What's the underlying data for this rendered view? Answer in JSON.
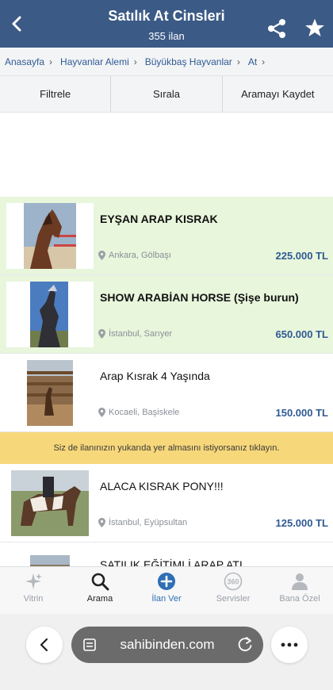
{
  "header": {
    "title": "Satılık At Cinsleri",
    "subtitle": "355 ilan",
    "back_icon": "chevron-left-icon",
    "share_icon": "share-icon",
    "favorite_icon": "star-icon"
  },
  "breadcrumb": [
    {
      "label": "Anasayfa"
    },
    {
      "label": "Hayvanlar Alemi"
    },
    {
      "label": "Büyükbaş Hayvanlar"
    },
    {
      "label": "At"
    }
  ],
  "filterbar": {
    "filter_label": "Filtrele",
    "sort_label": "Sırala",
    "save_label": "Aramayı Kaydet"
  },
  "listings": [
    {
      "title": "EYŞAN ARAP KISRAK",
      "location": "Ankara, Gölbaşı",
      "price": "225.000 TL",
      "featured": true
    },
    {
      "title": "SHOW ARABİAN HORSE (Şişe burun)",
      "location": "İstanbul, Sarıyer",
      "price": "650.000 TL",
      "featured": true
    },
    {
      "title": "Arap Kısrak 4 Yaşında",
      "location": "Kocaeli, Başiskele",
      "price": "150.000 TL",
      "featured": false
    },
    {
      "title": "ALACA KISRAK PONY!!!",
      "location": "İstanbul, Eyüpsultan",
      "price": "125.000 TL",
      "featured": false
    },
    {
      "title": "SATILIK EĞİTİMLİ ARAP ATI",
      "location": "",
      "price": "",
      "featured": false
    }
  ],
  "promo": {
    "text": "Siz de ilanınızın yukarıda yer almasını istiyorsanız tıklayın."
  },
  "tabbar": [
    {
      "label": "Vitrin",
      "icon": "sparkle-icon"
    },
    {
      "label": "Arama",
      "icon": "search-icon"
    },
    {
      "label": "İlan Ver",
      "icon": "plus-circle-icon"
    },
    {
      "label": "Servisler",
      "icon": "360-icon"
    },
    {
      "label": "Bana Özel",
      "icon": "person-icon"
    }
  ],
  "browser": {
    "domain": "sahibinden.com",
    "back_icon": "chevron-left-icon",
    "page_icon": "page-settings-icon",
    "reload_icon": "reload-icon",
    "more_icon": "more-icon"
  },
  "colors": {
    "header": "#3b5a86",
    "featured": "#e8f6dc",
    "price": "#2f5a94",
    "promo": "#f6d77a",
    "active_tab": "#2f6fb3"
  }
}
